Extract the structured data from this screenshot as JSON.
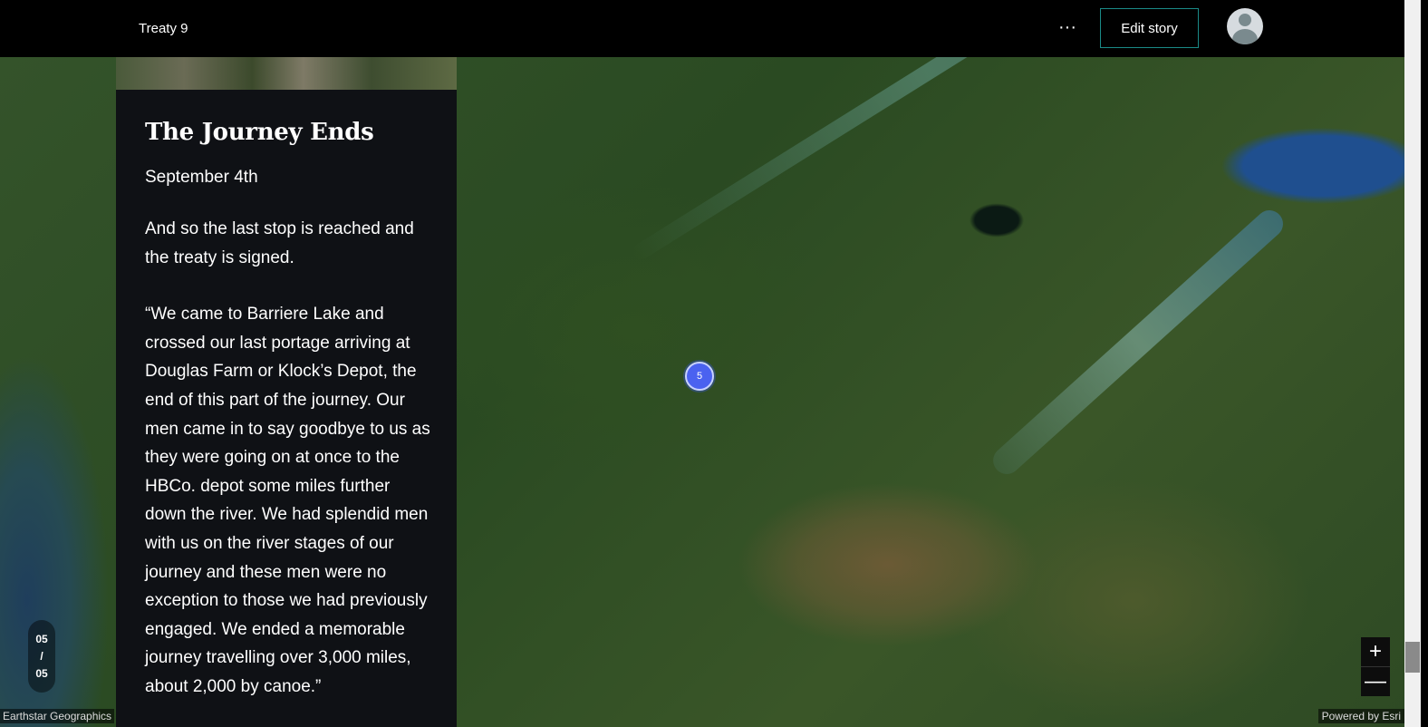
{
  "header": {
    "title": "Treaty 9",
    "more_icon": "more-horizontal-icon",
    "more_label": "···",
    "edit_label": "Edit story",
    "avatar_icon": "user-avatar-icon"
  },
  "panel": {
    "title": "The Journey Ends",
    "date": "September 4th",
    "paragraphs": [
      "And so the last stop is reached and the treaty is signed.",
      "“We came to Barriere Lake and crossed our last portage arriving at Douglas Farm or Klock’s Depot, the end of this part of the journey. Our men came in to say goodbye to us as they were going on at once to the HBCo. depot some miles further down the river. We had splendid men with us on the river stages of our journey and these men were no exception to those we had previously engaged. We ended a memorable journey travelling over 3,000 miles, about 2,000 by canoe.”"
    ]
  },
  "progress": {
    "current": "05",
    "separator": "/",
    "total": "05"
  },
  "map": {
    "marker_count": "5",
    "zoom_in_label": "+",
    "zoom_out_label": "—",
    "attribution_left": "Earthstar Geographics",
    "attribution_right": "Powered by Esri"
  },
  "colors": {
    "accent": "#1a8a87",
    "marker": "#4a62f0",
    "panel_bg": "#0f1115"
  }
}
